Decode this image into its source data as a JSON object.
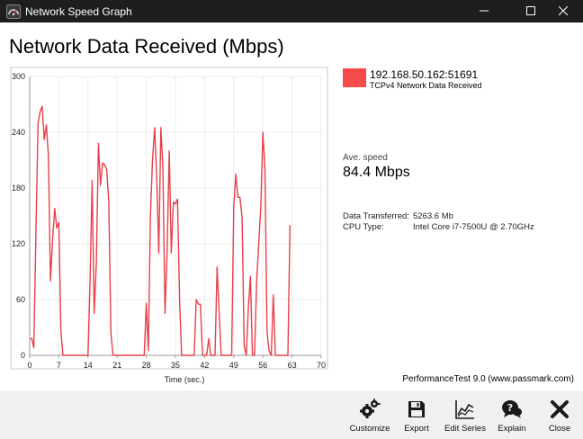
{
  "window": {
    "title": "Network Speed Graph"
  },
  "heading": "Network Data Received (Mbps)",
  "chart_data": {
    "type": "line",
    "xlabel": "Time (sec.)",
    "ylabel": "",
    "xlim": [
      0,
      70
    ],
    "ylim": [
      0,
      300
    ],
    "x_ticks": [
      0,
      7,
      14,
      21,
      28,
      35,
      42,
      49,
      56,
      63,
      70
    ],
    "y_ticks": [
      0,
      60,
      120,
      180,
      240,
      300
    ],
    "grid": true,
    "series": [
      {
        "name": "192.168.50.162:51691",
        "color": "#e8404a",
        "x": [
          0,
          0.5,
          1,
          1.5,
          2,
          2.5,
          3,
          3.5,
          4,
          4.5,
          5,
          5.5,
          6,
          6.5,
          7,
          7.5,
          8,
          8.5,
          9,
          10,
          11,
          12,
          13,
          14,
          14.5,
          15,
          15.5,
          16,
          16.5,
          17,
          17.5,
          18,
          18.5,
          19,
          19.5,
          20,
          20.5,
          21,
          21.5,
          22,
          23,
          24,
          25,
          26,
          27,
          27.5,
          28,
          28.5,
          29,
          29.5,
          30,
          30.5,
          31,
          31.5,
          32,
          32.5,
          33,
          33.5,
          34,
          34.5,
          35,
          35.5,
          36,
          36.5,
          37,
          37.5,
          38,
          38.5,
          39,
          39.5,
          40,
          40.5,
          41,
          41.5,
          42,
          42.5,
          43,
          43.5,
          44,
          44.5,
          45,
          45.5,
          46,
          46.5,
          47,
          47.5,
          48,
          48.5,
          49,
          49.5,
          50,
          50.5,
          51,
          51.5,
          52,
          52.5,
          53,
          53.5,
          54,
          54.5,
          55,
          55.5,
          56,
          56.5,
          57,
          57.5,
          58,
          58.5,
          59,
          59.5,
          60,
          60.5,
          61,
          61.5,
          62,
          62.5
        ],
        "y": [
          18,
          18,
          8,
          130,
          250,
          262,
          268,
          232,
          248,
          215,
          80,
          125,
          158,
          137,
          143,
          26,
          0,
          0,
          0,
          0,
          0,
          0,
          0,
          0,
          80,
          188,
          45,
          100,
          228,
          183,
          207,
          205,
          200,
          165,
          24,
          0,
          0,
          0,
          0,
          0,
          0,
          0,
          0,
          0,
          0,
          0,
          56,
          5,
          150,
          210,
          245,
          190,
          110,
          245,
          200,
          45,
          110,
          220,
          110,
          165,
          163,
          168,
          60,
          0,
          0,
          0,
          0,
          0,
          0,
          0,
          60,
          55,
          55,
          0,
          0,
          0,
          18,
          0,
          0,
          0,
          95,
          45,
          0,
          0,
          0,
          0,
          0,
          0,
          158,
          195,
          170,
          170,
          148,
          10,
          0,
          50,
          85,
          0,
          0,
          80,
          120,
          160,
          240,
          200,
          25,
          5,
          0,
          65,
          0,
          0,
          0,
          0,
          0,
          0,
          0,
          140
        ]
      }
    ]
  },
  "legend": {
    "series_name": "192.168.50.162:51691",
    "series_subtitle": "TCPv4 Network Data Received",
    "swatch_color": "#f74a4a"
  },
  "stats": {
    "ave_label": "Ave. speed",
    "ave_value": "84.4 Mbps",
    "data_label": "Data Transferred:",
    "data_value": "5263.6 Mb",
    "cpu_label": "CPU Type:",
    "cpu_value": "Intel Core i7-7500U @ 2.70GHz"
  },
  "credit": "PerformanceTest 9.0 (www.passmark.com)",
  "toolbar": {
    "customize": "Customize",
    "export": "Export",
    "edit_series": "Edit Series",
    "explain": "Explain",
    "close": "Close"
  },
  "colors": {
    "titlebar": "#1e1e1e",
    "toolbar": "#f0f0f0",
    "line": "#e8404a"
  },
  "icons": {
    "app": "gauge-icon",
    "minimize": "minimize-icon",
    "maximize": "maximize-icon",
    "close": "close-icon",
    "customize": "gears-icon",
    "export": "floppy-disk-icon",
    "edit_series": "line-chart-icon",
    "explain": "help-bubble-icon",
    "close_tool": "x-icon"
  }
}
